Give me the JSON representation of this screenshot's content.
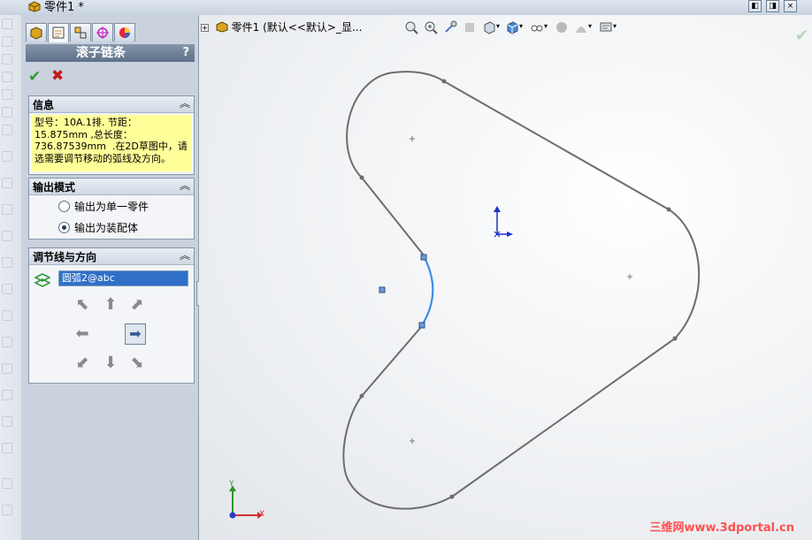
{
  "window": {
    "title": "零件1 *",
    "buttons": [
      "◧",
      "◨",
      "×"
    ]
  },
  "property_manager": {
    "title": "滚子链条",
    "help": "?",
    "ok_symbol": "✔",
    "cancel_symbol": "✖",
    "tabs": [
      "feature-manager",
      "property-manager",
      "configuration-manager",
      "dimxpert-manager",
      "display-manager"
    ],
    "info_group": {
      "label": "信息",
      "message": "型号：10A.1排. 节距：\n15.875mm ,总长度：\n736.87539mm  .在2D草图中，请\n选需要调节移动的弧线及方向。"
    },
    "output_group": {
      "label": "输出模式",
      "options": [
        "输出为单一零件",
        "输出为装配体"
      ],
      "selected": "输出为装配体"
    },
    "adjust_group": {
      "label": "调节线与方向",
      "selection": "圆弧2@abc",
      "arrows": {
        "up_left": "⬉",
        "up": "⬆",
        "up_right": "⬈",
        "left": "⬅",
        "right": "➡",
        "down_left": "⬋",
        "down": "⬇",
        "down_right": "⬊"
      }
    }
  },
  "graphics": {
    "tree_item": "零件1  (默认<<默认>_显...",
    "tree_expander": "+",
    "triad": {
      "x": "X",
      "y": "Y"
    },
    "watermark": "三维网www.3dportal.cn",
    "colors": {
      "sketch": "#6d6d6d",
      "selected_arc": "#3d8ee8",
      "point_fill": "#6c9bd6"
    }
  }
}
